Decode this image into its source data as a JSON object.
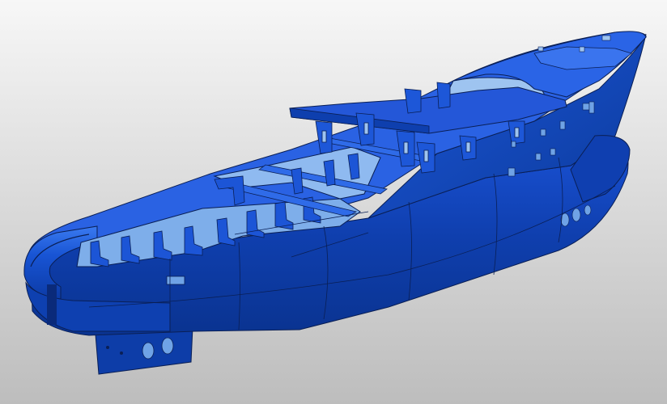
{
  "viewport": {
    "background_top": "#f7f7f7",
    "background_bottom": "#bdbdbd"
  },
  "model": {
    "subject": "ship-hull-cad-model",
    "colors": {
      "hull_dark": "#0b3d9c",
      "hull_mid": "#1448c4",
      "hull_light": "#1f5be0",
      "deck": "#2a64e6",
      "frame_light": "#6fa3e6",
      "frame_pale": "#9ec4f0",
      "edge": "#0a1f55"
    }
  }
}
